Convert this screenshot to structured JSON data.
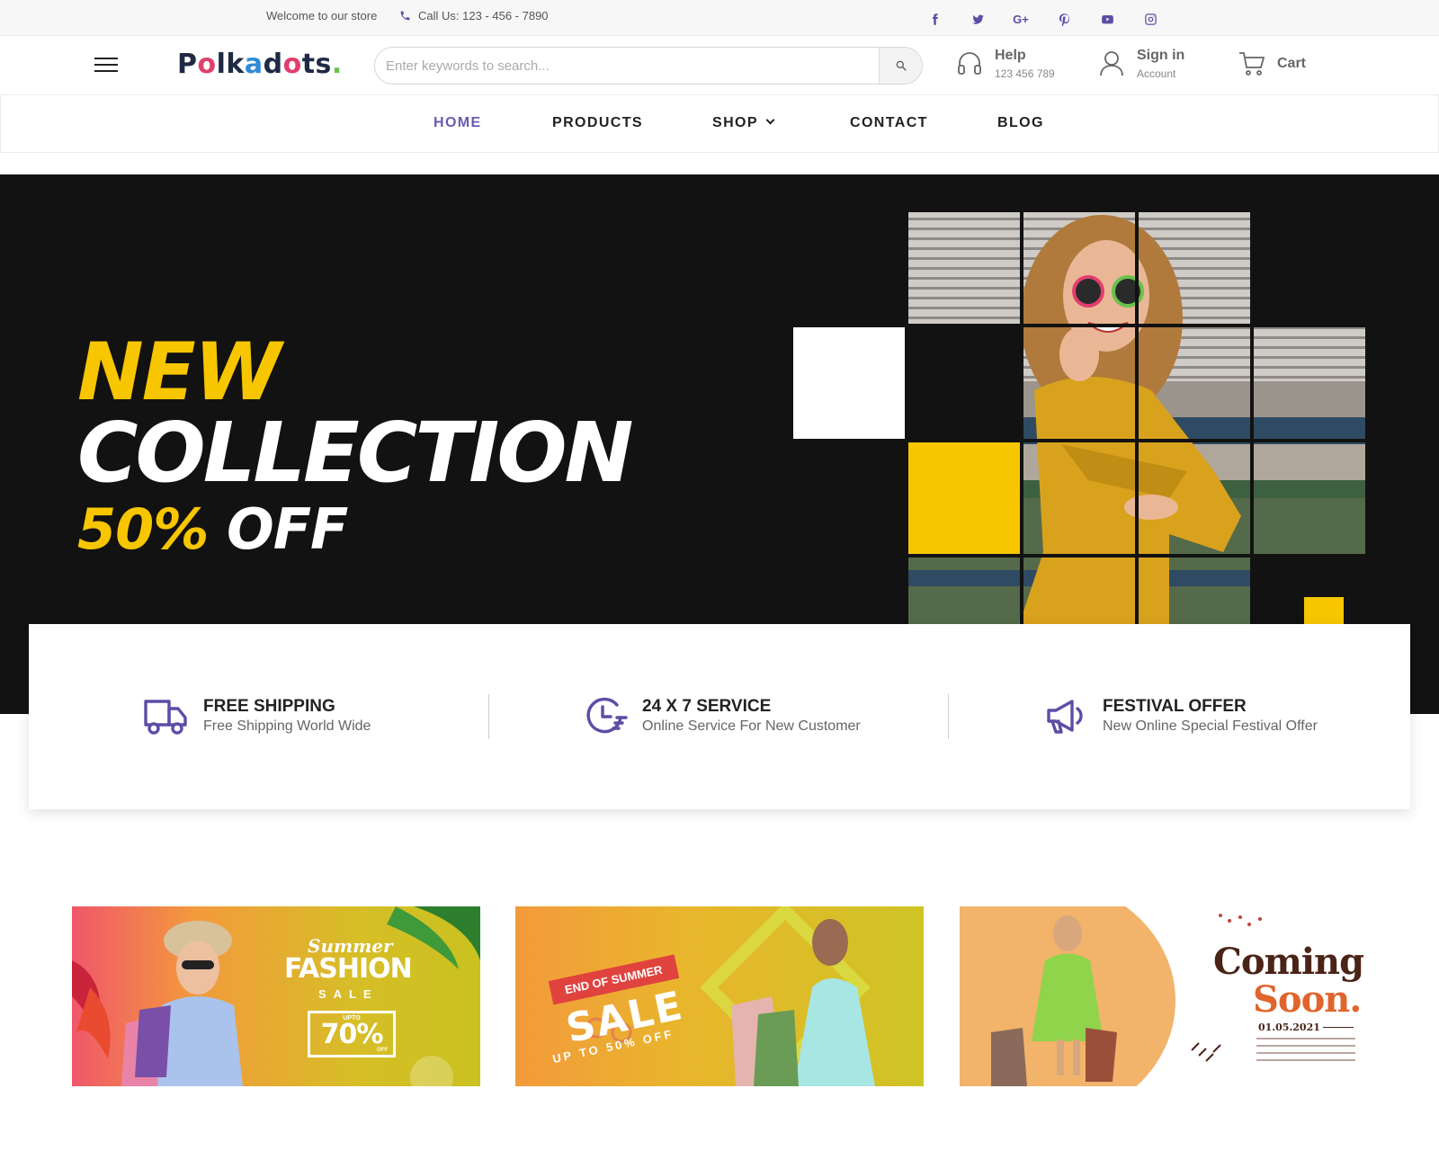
{
  "topbar": {
    "welcome": "Welcome to our store",
    "call": "Call Us: 123 - 456 - 7890",
    "socials": [
      "facebook-icon",
      "twitter-icon",
      "google-plus-icon",
      "pinterest-icon",
      "youtube-icon",
      "instagram-icon"
    ],
    "google_plus_label": "G+"
  },
  "header": {
    "logo": "Polkadots",
    "search_placeholder": "Enter keywords to search...",
    "help_title": "Help",
    "help_sub": "123 456 789",
    "signin_title": "Sign in",
    "signin_sub": "Account",
    "cart_title": "Cart"
  },
  "nav": {
    "items": [
      {
        "label": "HOME",
        "active": true
      },
      {
        "label": "PRODUCTS"
      },
      {
        "label": "SHOP"
      },
      {
        "label": "CONTACT"
      },
      {
        "label": "BLOG"
      }
    ]
  },
  "hero": {
    "line1": "NEW",
    "line2": "COLLECTION",
    "line3_pct": "50%",
    "line3_off": "OFF"
  },
  "features": [
    {
      "title": "FREE SHIPPING",
      "subtitle": "Free Shipping World Wide",
      "icon": "truck-icon"
    },
    {
      "title": "24 X 7 SERVICE",
      "subtitle": "Online Service For New Customer",
      "icon": "clock-service-icon"
    },
    {
      "title": "FESTIVAL OFFER",
      "subtitle": "New Online Special Festival Offer",
      "icon": "megaphone-icon"
    }
  ],
  "banners": {
    "b1": {
      "summer": "Summer",
      "fashion": "FASHION",
      "sale": "SALE",
      "upto": "UPTO",
      "pct": "70%",
      "off": "OFF"
    },
    "b2": {
      "ribbon": "END OF SUMMER",
      "sale": "SALE",
      "upto": "UP TO 50% OFF"
    },
    "b3": {
      "coming": "Coming",
      "soon": "Soon.",
      "date": "01.05.2021"
    }
  },
  "colors": {
    "accent": "#5b4ea6",
    "hero_bg": "#121212",
    "hero_yellow": "#f7c600"
  }
}
